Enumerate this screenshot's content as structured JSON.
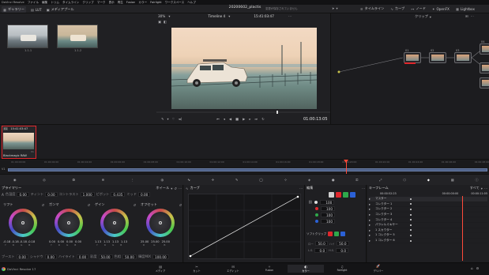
{
  "menubar": {
    "app_menu": "DaVinci Resolve",
    "items": [
      "ファイル",
      "編集",
      "トリム",
      "タイムライン",
      "クリップ",
      "マーク",
      "表示",
      "再生",
      "Fusion",
      "カラー",
      "Fairlight",
      "ワークスペース",
      "ヘルプ"
    ]
  },
  "title_bar": {
    "project_title": "20200602_plactis",
    "status": "変更が保存されていません",
    "right_tools": [
      "タイムライン",
      "カーブ",
      "ノード",
      "OpenFX",
      "Lightbox"
    ]
  },
  "toolbar": {
    "items": [
      "ギャラリー",
      "LUT",
      "メディアプール"
    ],
    "zoom": "30%",
    "timeline_name": "Timeline 4",
    "timecode": "15:41:03:47",
    "clip_mode": "クリップ"
  },
  "gallery": {
    "stills": [
      {
        "label": "1.1.1"
      },
      {
        "label": "1.1.2"
      }
    ]
  },
  "viewer": {
    "timecode": "01:00:13:05"
  },
  "node_graph": {
    "nodes": [
      {
        "label": "01"
      },
      {
        "label": "02"
      },
      {
        "label": "03"
      },
      {
        "label": "04"
      }
    ]
  },
  "clip_strip": {
    "clips": [
      {
        "index": "01",
        "timecode": "15:41:03:47",
        "track": "V1",
        "label": "Blackmagic RAW"
      }
    ]
  },
  "timeline_ruler": {
    "track": "V1",
    "ticks": [
      "01:00:00:00",
      "01:00:02:00",
      "01:00:04:00",
      "01:00:06:00",
      "01:00:08:00",
      "01:00:10:00",
      "01:00:12:00",
      "01:00:14:00",
      "01:00:16:00",
      "01:00:18:00",
      "01:00:20:00",
      "01:00:22:00",
      "01:00:24:00",
      "01:00:26:00",
      "01:00:28:00"
    ]
  },
  "primaries": {
    "title": "プライマリー",
    "mode": "ホイール",
    "top_params": [
      {
        "label": "コントラスト",
        "value": "1.000"
      },
      {
        "label": "ピボット",
        "value": "0.435"
      },
      {
        "label": "ミッド",
        "value": "0.00"
      },
      {
        "label": "色温度",
        "value": "0.00"
      },
      {
        "label": "ティント",
        "value": "0.00"
      }
    ],
    "wheels": [
      {
        "label": "リフト",
        "values": [
          "-0.18",
          "-0.18",
          "-0.18",
          "-0.18"
        ],
        "channels": [
          "Y",
          "R",
          "G",
          "B"
        ]
      },
      {
        "label": "ガンマ",
        "values": [
          "0.00",
          "0.00",
          "0.00",
          "0.00"
        ],
        "channels": [
          "Y",
          "R",
          "G",
          "B"
        ]
      },
      {
        "label": "ゲイン",
        "values": [
          "1.13",
          "1.13",
          "1.13",
          "1.13"
        ],
        "channels": [
          "Y",
          "R",
          "G",
          "B"
        ]
      },
      {
        "label": "オフセット",
        "values": [
          "25.00",
          "25.00",
          "25.00"
        ],
        "channels": [
          "R",
          "G",
          "B"
        ]
      }
    ],
    "bottom_params": [
      {
        "label": "ブースト",
        "value": "0.00"
      },
      {
        "label": "シャドウ",
        "value": "0.00"
      },
      {
        "label": "ハイライト",
        "value": "0.00"
      },
      {
        "label": "彩度",
        "value": "50.00"
      },
      {
        "label": "色相",
        "value": "50.00"
      },
      {
        "label": "輝度MIX",
        "value": "100.00"
      }
    ]
  },
  "curves": {
    "title": "カーブ",
    "edit_label": "編集",
    "channel_values": [
      "100",
      "100",
      "100",
      "100"
    ],
    "soft_clip_label": "ソフトクリップ",
    "soft_clip": {
      "low": "50.0",
      "high": "50.0",
      "ls": "0.0",
      "hs": "0.0"
    }
  },
  "keyframes": {
    "title": "キーフレーム",
    "mode": "すべて",
    "start_tc": "00:00:52:23",
    "end_tc": "00:00:00:00",
    "playhead_tc": "00:00:11:05",
    "rows": [
      "マスター",
      "コレクター 1",
      "コレクター 2",
      "コレクター 3",
      "コレクター 4",
      "パラレルミキサー",
      "1 スカウター",
      "1 コレクター 5",
      "1 コレクター 6"
    ]
  },
  "pages": {
    "app_name": "DaVinci Resolve 17",
    "items": [
      "メディア",
      "カット",
      "エディット",
      "Fusion",
      "カラー",
      "Fairlight",
      "デリバー"
    ],
    "active": "カラー"
  },
  "colors": {
    "accent_red": "#e0272c",
    "playhead": "#ff4a3a",
    "panel_bg": "#1f1f22",
    "orange": "#e0a040"
  }
}
